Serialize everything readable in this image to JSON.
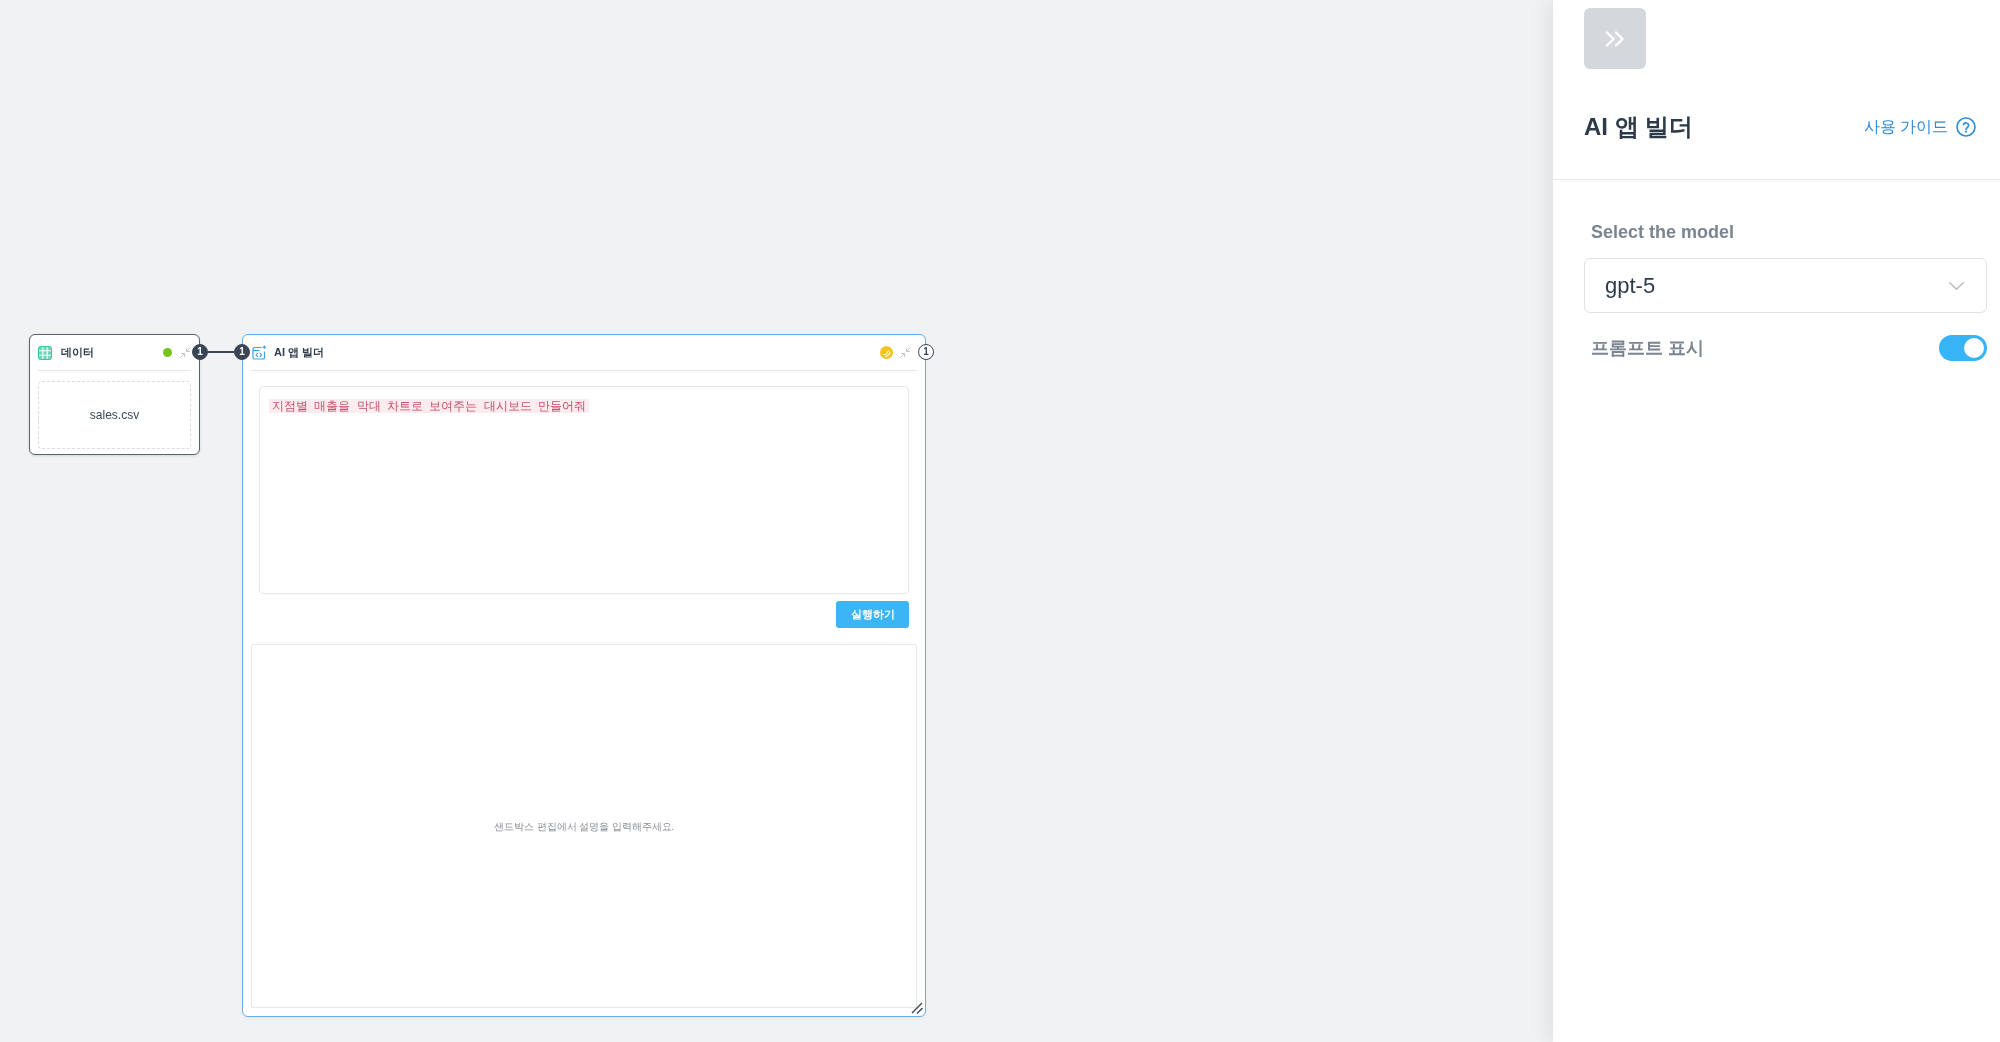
{
  "canvas": {
    "nodes": [
      {
        "kind": "data",
        "title": "데이터",
        "color": "#74c41c",
        "file": "sales.csv",
        "ports": [
          {
            "kind": "output",
            "label": "1",
            "connected": true
          }
        ]
      },
      {
        "kind": "app_builder",
        "title": "AI 앱 빌더",
        "color": "#f6c31b",
        "ports": [
          {
            "kind": "input",
            "label": "1",
            "connected": true
          },
          {
            "kind": "output",
            "label": "1",
            "connected": false
          }
        ],
        "prompt": {
          "value": "지점별 매출을 막대 차트로 보여주는 대시보드 만들어줘"
        },
        "run_button": "실행하기",
        "preview_message": "샌드박스 편집에서 설명을 입력해주세요."
      }
    ]
  },
  "panel": {
    "title": "AI 앱 빌더",
    "guide_link": "사용 가이드",
    "model_label": "Select the model",
    "model_select": {
      "value": "gpt-5"
    },
    "prompt_toggle": {
      "label": "프롬프트 표시",
      "on": true
    }
  }
}
